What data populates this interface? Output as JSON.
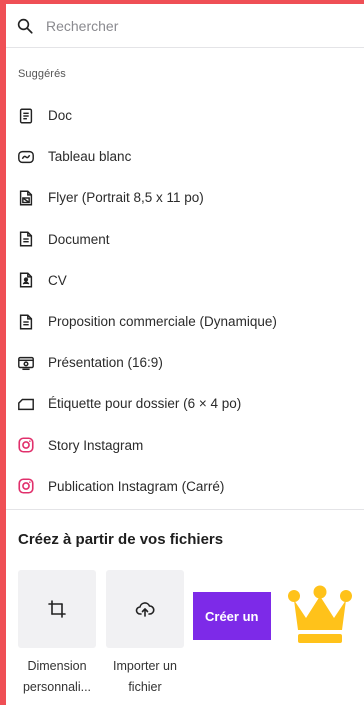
{
  "search": {
    "placeholder": "Rechercher",
    "value": ""
  },
  "suggested": {
    "label": "Suggérés",
    "items": [
      {
        "label": "Doc",
        "icon": "doc-icon"
      },
      {
        "label": "Tableau blanc",
        "icon": "whiteboard-icon"
      },
      {
        "label": "Flyer (Portrait 8,5 x 11 po)",
        "icon": "flyer-icon"
      },
      {
        "label": "Document",
        "icon": "document-icon"
      },
      {
        "label": "CV",
        "icon": "resume-icon"
      },
      {
        "label": "Proposition commerciale (Dynamique)",
        "icon": "proposal-icon"
      },
      {
        "label": "Présentation (16:9)",
        "icon": "presentation-icon"
      },
      {
        "label": "Étiquette pour dossier (6 × 4 po)",
        "icon": "folder-label-icon"
      },
      {
        "label": "Story Instagram",
        "icon": "instagram-icon"
      },
      {
        "label": "Publication Instagram (Carré)",
        "icon": "instagram-icon"
      }
    ]
  },
  "files": {
    "title": "Créez à partir de vos fichiers",
    "custom_size": {
      "line1": "Dimension",
      "line2": "personnali..."
    },
    "import": {
      "line1": "Importer un",
      "line2": "fichier"
    },
    "create_label": "Créer un"
  },
  "colors": {
    "background": "#ef4f55",
    "accent": "#7d2ae8",
    "crown": "#ffc21a",
    "instagram": "#e1306c"
  }
}
